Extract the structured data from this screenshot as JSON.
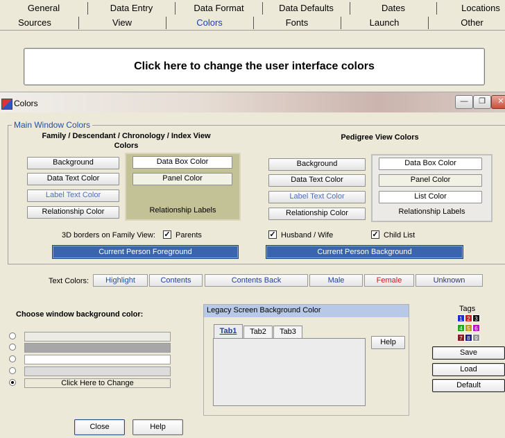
{
  "top_tabs": {
    "row1": [
      "General",
      "Data Entry",
      "Data Format",
      "Data Defaults",
      "Dates",
      "Locations"
    ],
    "row2": [
      "Sources",
      "View",
      "Colors",
      "Fonts",
      "Launch",
      "Other"
    ],
    "active": "Colors"
  },
  "change_ui_colors_button": "Click here to change the user interface colors",
  "window": {
    "title": "Colors",
    "minimize_glyph": "—",
    "restore_glyph": "❐",
    "close_glyph": "✕"
  },
  "main_window_colors": {
    "group_label": "Main Window Colors",
    "family_view": {
      "header": "Family / Descendant / Chronology / Index View Colors",
      "background": "Background",
      "data_text_color": "Data Text Color",
      "label_text_color": "Label Text Color",
      "relationship_color": "Relationship Color",
      "data_box_color": "Data Box Color",
      "panel_color": "Panel Color",
      "relationship_labels": "Relationship Labels"
    },
    "pedigree_view": {
      "header": "Pedigree View Colors",
      "background": "Background",
      "data_text_color": "Data Text Color",
      "label_text_color": "Label Text Color",
      "relationship_color": "Relationship Color",
      "data_box_color": "Data Box Color",
      "panel_color": "Panel Color",
      "list_color": "List Color",
      "relationship_labels": "Relationship Labels"
    },
    "borders_label": "3D borders on Family View:",
    "checkboxes": {
      "parents": {
        "label": "Parents",
        "checked": true
      },
      "husband_wife": {
        "label": "Husband / Wife",
        "checked": true
      },
      "child_list": {
        "label": "Child List",
        "checked": true
      }
    },
    "check_glyph": "✓",
    "current_person_foreground": "Current Person Foreground",
    "current_person_background": "Current Person Background"
  },
  "text_colors": {
    "label": "Text Colors:",
    "buttons": [
      {
        "label": "Highlight",
        "color": "#1f4f9a"
      },
      {
        "label": "Contents",
        "color": "#1f3f8f"
      },
      {
        "label": "Contents Back",
        "color": "#1f3f8f"
      },
      {
        "label": "Male",
        "color": "#1f3fa0"
      },
      {
        "label": "Female",
        "color": "#d01818"
      },
      {
        "label": "Unknown",
        "color": "#2d2d8f"
      }
    ]
  },
  "window_background": {
    "label": "Choose window background color:",
    "options": [
      {
        "color": "#ecebe6",
        "selected": false,
        "text": ""
      },
      {
        "color": "#a7a7a7",
        "selected": false,
        "text": ""
      },
      {
        "color": "#ffffff",
        "selected": false,
        "text": ""
      },
      {
        "color": "#dcdcdc",
        "selected": false,
        "text": ""
      },
      {
        "color": "#ece9d8",
        "selected": true,
        "text": "Click Here to Change"
      }
    ]
  },
  "legacy": {
    "title": "Legacy Screen Background Color",
    "tabs": [
      "Tab1",
      "Tab2",
      "Tab3"
    ],
    "help": "Help"
  },
  "tags": {
    "label": "Tags",
    "items": [
      {
        "n": "1",
        "color": "#1c2fd0"
      },
      {
        "n": "2",
        "color": "#d01c1c"
      },
      {
        "n": "3",
        "color": "#111111"
      },
      {
        "n": "4",
        "color": "#1fa81f"
      },
      {
        "n": "5",
        "color": "#c09a1a"
      },
      {
        "n": "6",
        "color": "#b01ac0"
      },
      {
        "n": "7",
        "color": "#8a1c1c"
      },
      {
        "n": "8",
        "color": "#1c1c8a"
      },
      {
        "n": "9",
        "color": "#8f8f8f"
      }
    ]
  },
  "side_buttons": {
    "save": "Save",
    "load": "Load",
    "default": "Default"
  },
  "bottom_buttons": {
    "close": "Close",
    "help": "Help"
  }
}
